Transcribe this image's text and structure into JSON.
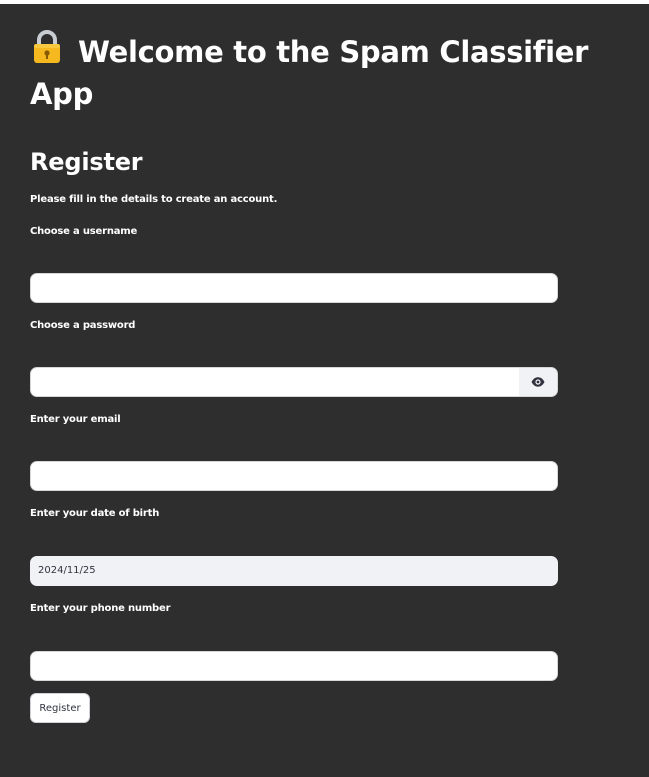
{
  "header": {
    "title_icon": "lock-icon",
    "title": "Welcome to the Spam Classifier App"
  },
  "form": {
    "heading": "Register",
    "intro": "Please fill in the details to create an account.",
    "fields": {
      "username": {
        "label": "Choose a username",
        "value": ""
      },
      "password": {
        "label": "Choose a password",
        "value": "",
        "toggle_icon": "eye-icon"
      },
      "email": {
        "label": "Enter your email",
        "value": ""
      },
      "dob": {
        "label": "Enter your date of birth",
        "value": "2024/11/25"
      },
      "phone": {
        "label": "Enter your phone number",
        "value": ""
      }
    },
    "submit_label": "Register"
  },
  "colors": {
    "background": "#2e2e2e",
    "text": "#ffffff",
    "input_bg": "#ffffff",
    "date_bg": "#f0f2f6",
    "lock_body": "#f5b81e"
  }
}
